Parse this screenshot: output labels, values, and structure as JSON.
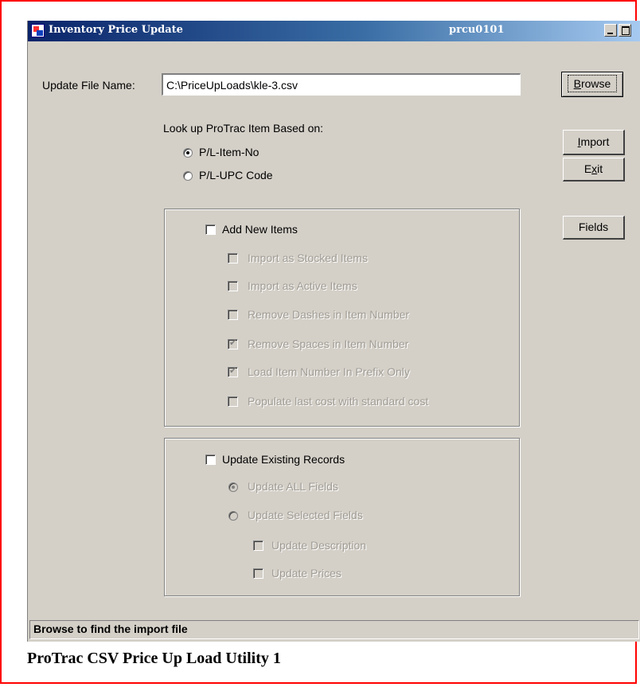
{
  "window": {
    "title": "Inventory Price Update",
    "code": "prcu0101"
  },
  "file": {
    "label": "Update File Name:",
    "value": "C:\\PriceUpLoads\\kle-3.csv"
  },
  "buttons": {
    "browse": "Browse",
    "import": "Import",
    "exit": "Exit",
    "fields": "Fields"
  },
  "lookup": {
    "heading": "Look up ProTrac Item Based on:",
    "options": [
      {
        "label": "P/L-Item-No",
        "selected": true
      },
      {
        "label": "P/L-UPC Code",
        "selected": false
      }
    ]
  },
  "add_new": {
    "label": "Add New Items",
    "checked": false,
    "options": [
      {
        "label": "Import as Stocked Items",
        "checked": false
      },
      {
        "label": "Import as Active Items",
        "checked": false
      },
      {
        "label": "Remove Dashes in Item Number",
        "checked": false
      },
      {
        "label": "Remove Spaces in Item Number",
        "checked": true
      },
      {
        "label": "Load Item Number In Prefix Only",
        "checked": true
      },
      {
        "label": "Populate last cost with standard cost",
        "checked": false
      }
    ]
  },
  "update_existing": {
    "label": "Update Existing Records",
    "checked": false,
    "modes": [
      {
        "label": "Update ALL Fields",
        "selected": true
      },
      {
        "label": "Update Selected Fields",
        "selected": false
      }
    ],
    "fields": [
      {
        "label": "Update Description",
        "checked": false
      },
      {
        "label": "Update Prices",
        "checked": false
      }
    ]
  },
  "status": "Browse to find the import file",
  "caption": "ProTrac CSV Price Up Load Utility 1",
  "colors": {
    "frame_border": "#ff0000",
    "dialog_bg": "#d4d0c8",
    "titlebar_start": "#0a246a",
    "titlebar_end": "#a6caf0"
  }
}
